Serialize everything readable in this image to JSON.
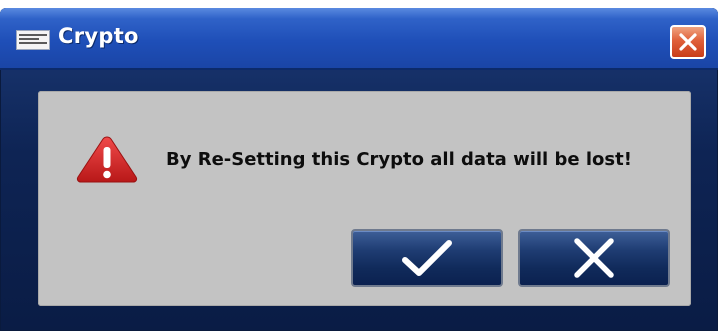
{
  "window": {
    "title": "Crypto"
  },
  "dialog": {
    "message": "By Re-Setting this Crypto all data will be lost!",
    "icon": "warning-icon",
    "buttons": [
      {
        "name": "confirm",
        "icon": "checkmark-icon"
      },
      {
        "name": "cancel",
        "icon": "x-icon"
      }
    ]
  },
  "colors": {
    "titlebar": "#1f4fb8",
    "frame": "#0e2454",
    "panel": "#c3c3c3",
    "button": "#1f3d73",
    "close_button": "#e0603a",
    "warning": "#d42a2a"
  }
}
